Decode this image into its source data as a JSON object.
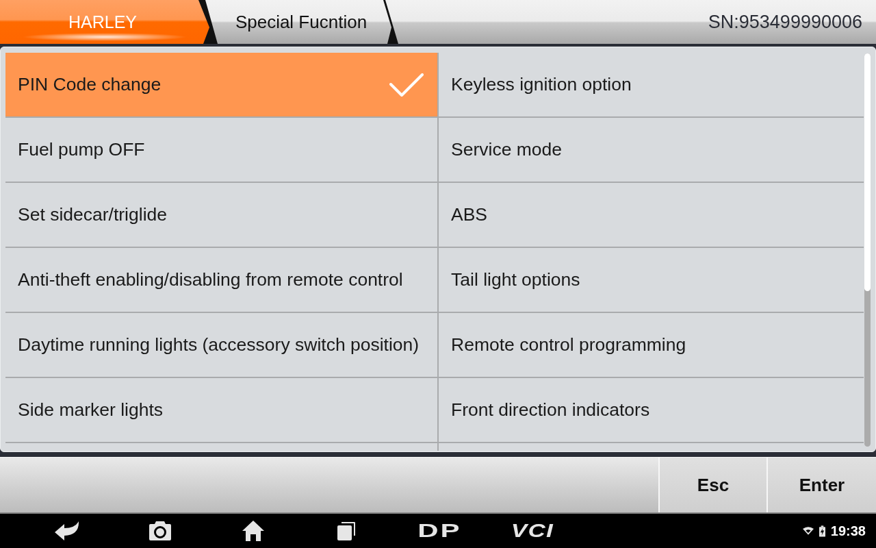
{
  "breadcrumb": [
    {
      "label": "HARLEY",
      "selected": true
    },
    {
      "label": "Special Fucntion",
      "selected": false
    }
  ],
  "serial_number": "SN:953499990006",
  "functions": [
    {
      "label": "PIN Code change",
      "selected": true
    },
    {
      "label": "Keyless ignition option",
      "selected": false
    },
    {
      "label": "Fuel pump OFF",
      "selected": false
    },
    {
      "label": "Service mode",
      "selected": false
    },
    {
      "label": "Set sidecar/triglide",
      "selected": false
    },
    {
      "label": "ABS",
      "selected": false
    },
    {
      "label": "Anti-theft enabling/disabling from remote control",
      "selected": false
    },
    {
      "label": "Tail light options",
      "selected": false
    },
    {
      "label": "Daytime running lights (accessory switch position)",
      "selected": false
    },
    {
      "label": "Remote control programming",
      "selected": false
    },
    {
      "label": "Side marker lights",
      "selected": false
    },
    {
      "label": "Front direction indicators",
      "selected": false
    }
  ],
  "buttons": [
    "Esc",
    "Enter"
  ],
  "nav_bar": {
    "logos": [
      "DP",
      "VCI"
    ],
    "time": "19:38"
  }
}
